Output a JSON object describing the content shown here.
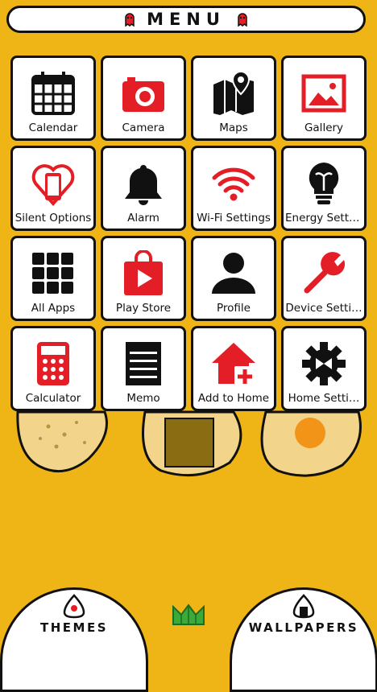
{
  "header": {
    "title": "MENU"
  },
  "apps": [
    {
      "label": "Calendar",
      "icon": "calendar-icon"
    },
    {
      "label": "Camera",
      "icon": "camera-icon"
    },
    {
      "label": "Maps",
      "icon": "map-icon"
    },
    {
      "label": "Gallery",
      "icon": "gallery-icon"
    },
    {
      "label": "Silent Options",
      "icon": "heart-phone-icon"
    },
    {
      "label": "Alarm",
      "icon": "bell-icon"
    },
    {
      "label": "Wi-Fi Settings",
      "icon": "wifi-icon"
    },
    {
      "label": "Energy Setti…",
      "icon": "lightbulb-icon"
    },
    {
      "label": "All Apps",
      "icon": "grid-icon"
    },
    {
      "label": "Play Store",
      "icon": "store-bag-icon"
    },
    {
      "label": "Profile",
      "icon": "person-icon"
    },
    {
      "label": "Device Setti…",
      "icon": "wrench-icon"
    },
    {
      "label": "Calculator",
      "icon": "calculator-icon"
    },
    {
      "label": "Memo",
      "icon": "memo-icon"
    },
    {
      "label": "Add to Home",
      "icon": "add-home-icon"
    },
    {
      "label": "Home Setti…",
      "icon": "gear-icon"
    }
  ],
  "bottom": {
    "themes_label": "THEMES",
    "wallpapers_label": "WALLPAPERS"
  },
  "colors": {
    "background": "#efb516",
    "accent": "#e41e26",
    "ink": "#111111"
  }
}
